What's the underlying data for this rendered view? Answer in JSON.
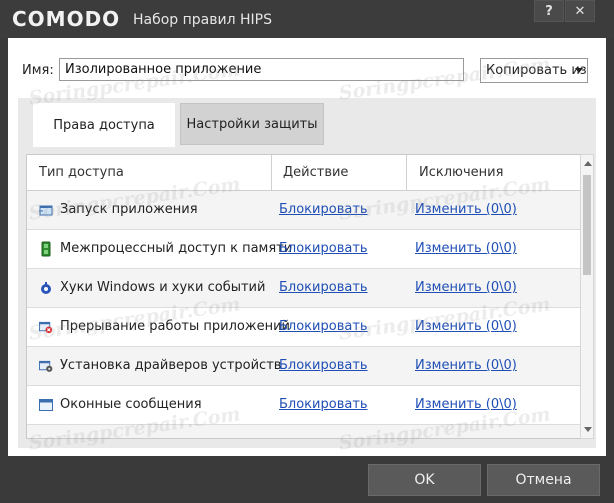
{
  "window": {
    "brand": "COMODO",
    "title": "Набор правил HIPS",
    "help_label": "?",
    "close_label": "✕"
  },
  "name_row": {
    "label": "Имя:",
    "value": "Изолированное приложение",
    "copy_from_label": "Копировать из"
  },
  "tabs": [
    {
      "label": "Права доступа",
      "active": true
    },
    {
      "label": "Настройки защиты",
      "active": false
    }
  ],
  "table": {
    "columns": [
      "Тип доступа",
      "Действие",
      "Исключения"
    ],
    "rows": [
      {
        "icon": "run-app-icon",
        "type": "Запуск приложения",
        "action": "Блокировать",
        "exceptions": "Изменить (0\\0)"
      },
      {
        "icon": "memory-icon",
        "type": "Межпроцессный доступ к памяти",
        "action": "Блокировать",
        "exceptions": "Изменить (0\\0)"
      },
      {
        "icon": "hook-icon",
        "type": "Хуки Windows и хуки событий",
        "action": "Блокировать",
        "exceptions": "Изменить (0\\0)"
      },
      {
        "icon": "terminate-icon",
        "type": "Прерывание работы приложений",
        "action": "Блокировать",
        "exceptions": "Изменить (0\\0)"
      },
      {
        "icon": "driver-install-icon",
        "type": "Установка драйверов устройств",
        "action": "Блокировать",
        "exceptions": "Изменить (0\\0)"
      },
      {
        "icon": "window-messages-icon",
        "type": "Оконные сообщения",
        "action": "Блокировать",
        "exceptions": "Изменить (0\\0)"
      }
    ]
  },
  "footer": {
    "ok_label": "OK",
    "cancel_label": "Отмена"
  },
  "watermark": "Soringpcrepair.Com",
  "colors": {
    "titlebar": "#3c3c3c",
    "link": "#1f4fb5",
    "button": "#5a5a5a"
  }
}
